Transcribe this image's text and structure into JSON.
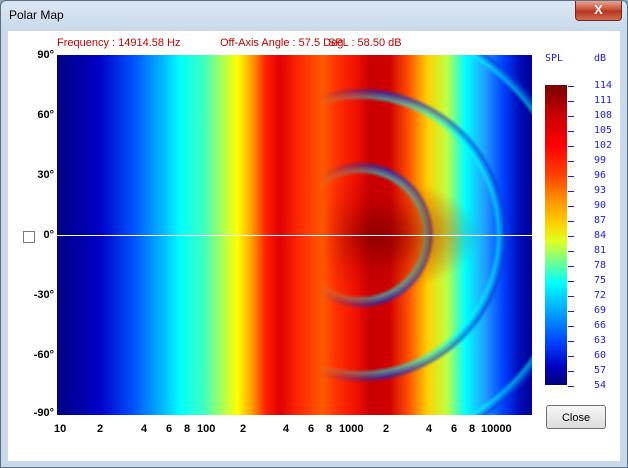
{
  "window": {
    "title": "Polar Map",
    "close_glyph": "X"
  },
  "info": {
    "frequency": "Frequency : 14914.58 Hz",
    "off_axis": "Off-Axis Angle : 57.5 Deg",
    "spl": "SPL : 58.50 dB"
  },
  "y_axis": {
    "ticks": [
      "90°",
      "60°",
      "30°",
      "0°",
      "-30°",
      "-60°",
      "-90°"
    ]
  },
  "x_axis": {
    "scale": "log",
    "ticks": [
      "10",
      "2",
      "4",
      "6",
      "8",
      "100",
      "2",
      "4",
      "6",
      "8",
      "1000",
      "2",
      "4",
      "6",
      "8",
      "10000"
    ]
  },
  "colorbar": {
    "head_left": "SPL",
    "head_right": "dB",
    "values": [
      "114",
      "111",
      "108",
      "105",
      "102",
      "99",
      "96",
      "93",
      "90",
      "87",
      "84",
      "81",
      "78",
      "75",
      "72",
      "69",
      "66",
      "63",
      "60",
      "57",
      "54"
    ]
  },
  "buttons": {
    "close": "Close"
  }
}
